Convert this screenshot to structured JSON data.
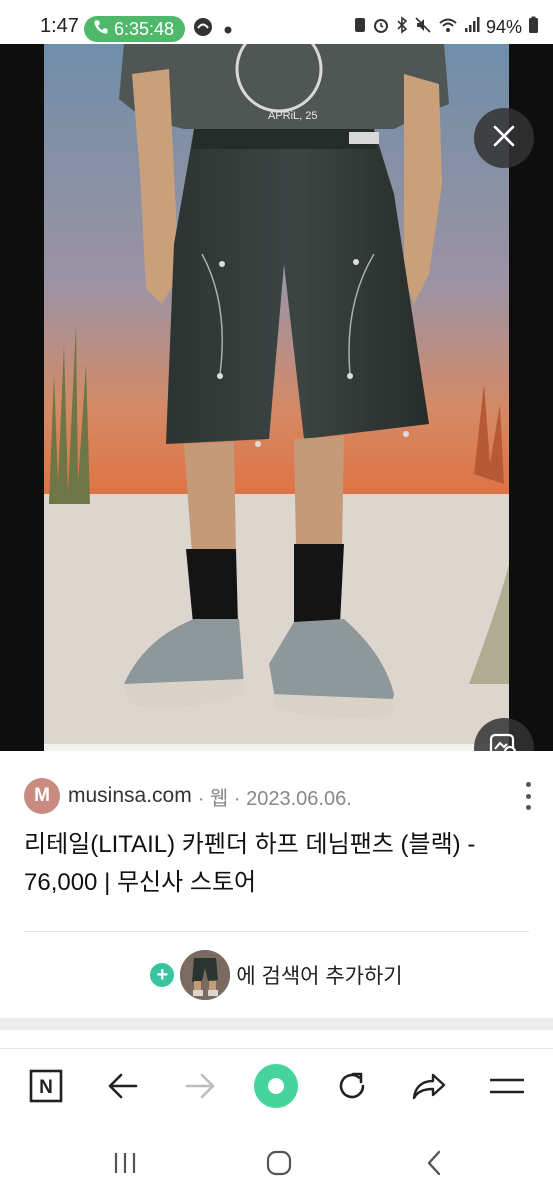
{
  "status_bar": {
    "time": "1:47",
    "call_timer": "6:35:48",
    "battery": "94%"
  },
  "image": {
    "shirt_text": "APRiL, 25"
  },
  "result": {
    "favicon_letter": "M",
    "site": "musinsa.com",
    "meta": "· 웹 · 2023.06.06.",
    "title": "리테일(LITAIL) 카펜더 하프 데님팬츠 (블랙) - 76,000 | 무신사 스토어",
    "add_search_label": "에 검색어 추가하기",
    "add_search_plus": "+"
  },
  "toolbar": {
    "home_glyph": "N"
  },
  "icons": {
    "close": "close-icon",
    "lens": "image-search-icon",
    "more": "more-vertical-icon",
    "back": "arrow-left-icon",
    "forward": "arrow-right-icon",
    "refresh": "refresh-icon",
    "share": "share-icon",
    "menu": "menu-icon",
    "recent": "recent-apps-icon",
    "home": "home-icon",
    "nav_back": "nav-back-icon"
  },
  "colors": {
    "call_green": "#4fb86a",
    "accent_green": "#39c39f",
    "favicon": "#c98a82"
  }
}
